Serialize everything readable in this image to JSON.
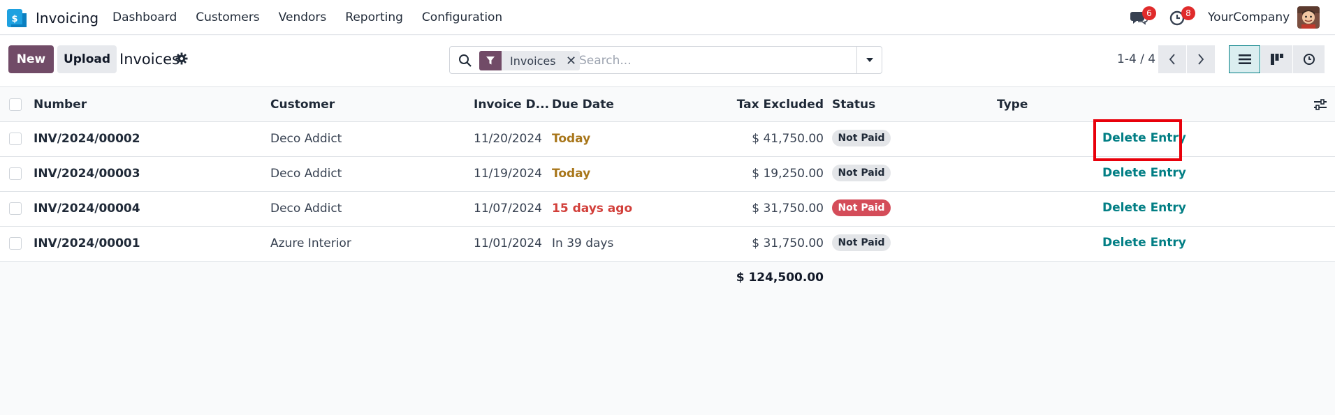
{
  "app": {
    "name": "Invoicing"
  },
  "nav": {
    "items": [
      "Dashboard",
      "Customers",
      "Vendors",
      "Reporting",
      "Configuration"
    ]
  },
  "systray": {
    "messages_count": "6",
    "activities_count": "8",
    "company": "YourCompany"
  },
  "control": {
    "new_label": "New",
    "upload_label": "Upload",
    "title": "Invoices",
    "search": {
      "facet": "Invoices",
      "placeholder": "Search..."
    },
    "pager": "1-4 / 4"
  },
  "table": {
    "headers": {
      "number": "Number",
      "customer": "Customer",
      "invoice_date": "Invoice D...",
      "due_date": "Due Date",
      "tax_excluded": "Tax Excluded",
      "status": "Status",
      "type": "Type"
    },
    "rows": [
      {
        "number": "INV/2024/00002",
        "customer": "Deco Addict",
        "invoice_date": "11/20/2024",
        "due_date": "Today",
        "tax_excluded": "$ 41,750.00",
        "status": "Not Paid",
        "action": "Delete Entry"
      },
      {
        "number": "INV/2024/00003",
        "customer": "Deco Addict",
        "invoice_date": "11/19/2024",
        "due_date": "Today",
        "tax_excluded": "$ 19,250.00",
        "status": "Not Paid",
        "action": "Delete Entry"
      },
      {
        "number": "INV/2024/00004",
        "customer": "Deco Addict",
        "invoice_date": "11/07/2024",
        "due_date": "15 days ago",
        "tax_excluded": "$ 31,750.00",
        "status": "Not Paid",
        "action": "Delete Entry"
      },
      {
        "number": "INV/2024/00001",
        "customer": "Azure Interior",
        "invoice_date": "11/01/2024",
        "due_date": "In 39 days",
        "tax_excluded": "$ 31,750.00",
        "status": "Not Paid",
        "action": "Delete Entry"
      }
    ],
    "total": "$ 124,500.00"
  },
  "colors": {
    "brand": "#714b67",
    "link": "#017e84",
    "due_today": "#a8761a",
    "overdue": "#d23f3a",
    "status_red": "#d44c59",
    "highlight": "#e8000b"
  }
}
